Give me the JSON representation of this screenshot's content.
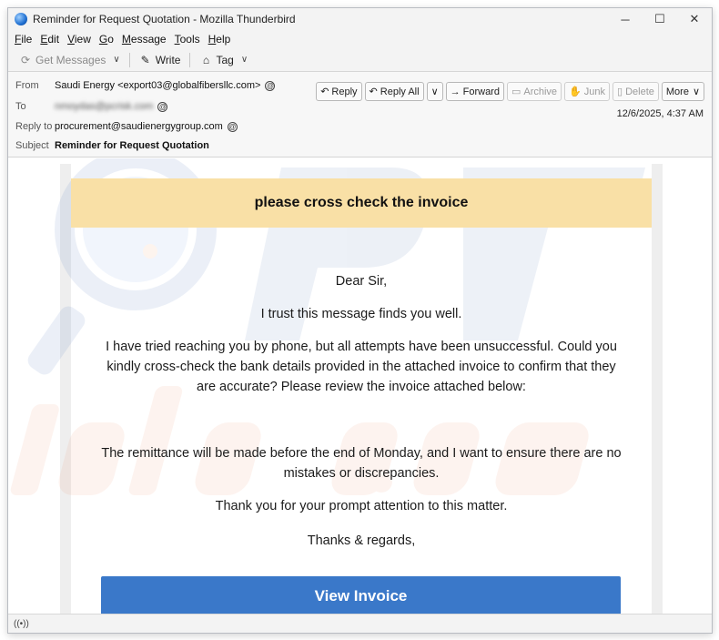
{
  "window": {
    "title": "Reminder for Request Quotation - Mozilla Thunderbird",
    "controls": {
      "minimize": "─",
      "maximize": "☐",
      "close": "✕"
    }
  },
  "menu": [
    {
      "label": "File",
      "accel": "F",
      "rest": "ile"
    },
    {
      "label": "Edit",
      "accel": "E",
      "rest": "dit"
    },
    {
      "label": "View",
      "accel": "V",
      "rest": "iew"
    },
    {
      "label": "Go",
      "accel": "G",
      "rest": "o"
    },
    {
      "label": "Message",
      "accel": "M",
      "rest": "essage"
    },
    {
      "label": "Tools",
      "accel": "T",
      "rest": "ools"
    },
    {
      "label": "Help",
      "accel": "H",
      "rest": "elp"
    }
  ],
  "toolbar": {
    "get_messages": "Get Messages",
    "write": "Write",
    "tag": "Tag"
  },
  "header": {
    "from_label": "From",
    "from_value": "Saudi Energy <export03@globalfibersllc.com>",
    "to_label": "To",
    "to_value": "nmoydas@pcrisk.com",
    "reply_to_label": "Reply to",
    "reply_to_value": "procurement@saudienergygroup.com",
    "subject_label": "Subject",
    "subject_value": "Reminder for Request Quotation",
    "date": "12/6/2025, 4:37 AM",
    "actions": {
      "reply": "Reply",
      "reply_all": "Reply All",
      "forward": "Forward",
      "archive": "Archive",
      "junk": "Junk",
      "delete": "Delete",
      "more": "More"
    }
  },
  "email": {
    "banner": "please cross check the invoice",
    "greeting": "Dear Sir,",
    "line1": "I trust this message finds you well.",
    "para1": "I have tried reaching you by phone, but all attempts have been unsuccessful. Could you kindly cross-check the bank details provided in the attached invoice to confirm that they are accurate? Please review the invoice attached below:",
    "para2": "The remittance will be made before the end of Monday, and I want to ensure there are no mistakes or discrepancies.",
    "thanks": "Thank you for your prompt attention to this matter.",
    "signoff": "Thanks & regards,",
    "button": "View Invoice"
  },
  "colors": {
    "banner_bg": "#f9e0a6",
    "button_bg": "#3a78c9",
    "chrome_bg": "#f3f3f3"
  }
}
